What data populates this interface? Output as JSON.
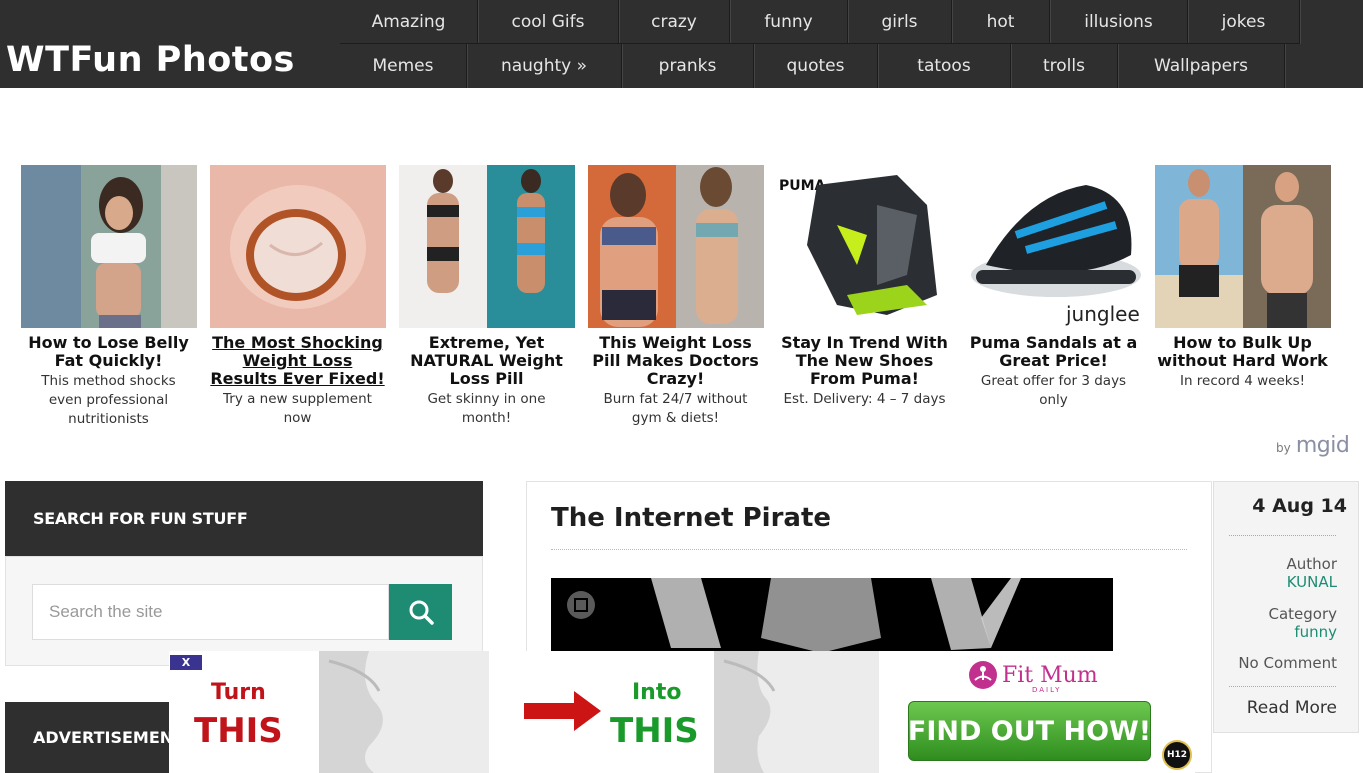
{
  "site": {
    "logo": "WTFun Photos"
  },
  "nav": {
    "row1": [
      "Amazing",
      "cool Gifs",
      "crazy",
      "funny",
      "girls",
      "hot",
      "illusions",
      "jokes"
    ],
    "row2": [
      "Memes",
      "naughty »",
      "pranks",
      "quotes",
      "tatoos",
      "trolls",
      "Wallpapers"
    ]
  },
  "ads": [
    {
      "title": "How to Lose Belly Fat Quickly!",
      "desc": "This method shocks even professional nutritionists",
      "underlined": false
    },
    {
      "title": "The Most Shocking Weight Loss Results Ever Fixed!",
      "desc": "Try a new supplement now",
      "underlined": true
    },
    {
      "title": "Extreme, Yet NATURAL Weight Loss Pill",
      "desc": "Get skinny in one month!",
      "underlined": false
    },
    {
      "title": "This Weight Loss Pill Makes Doctors Crazy!",
      "desc": "Burn fat 24/7 without gym & diets!",
      "underlined": false
    },
    {
      "title": "Stay In Trend With The New Shoes From Puma!",
      "desc": "Est. Delivery: 4 – 7 days",
      "underlined": false
    },
    {
      "title": "Puma Sandals at a Great Price!",
      "desc": "Great offer for 3 days only",
      "underlined": false
    },
    {
      "title": "How to Bulk Up without Hard Work",
      "desc": "In record 4 weeks!",
      "underlined": false
    }
  ],
  "ad_labels": {
    "puma": "PUMA",
    "junglee": "junglee"
  },
  "mgid": {
    "by": "by",
    "brand": "mgid"
  },
  "search": {
    "heading": "SEARCH FOR FUN STUFF",
    "placeholder": "Search the site"
  },
  "advert_heading": "ADVERTISEMENT",
  "post": {
    "title": "The Internet Pirate",
    "date": "4 Aug 14",
    "author_label": "Author",
    "author": "KUNAL",
    "category_label": "Category",
    "category": "funny",
    "comments": "No Comment",
    "read_more": "Read More"
  },
  "overlay_ad": {
    "close": "X",
    "turn": "Turn",
    "this1": "THIS",
    "into": "Into",
    "this2": "THIS",
    "brand": "Fit Mum",
    "brand_sub": "DAILY",
    "cta": "FIND OUT HOW!",
    "badge": "H12"
  },
  "colors": {
    "header_bg": "#2f2f2f",
    "accent_green": "#1e8c73",
    "ad_red": "#c0141a",
    "ad_green": "#1a9a2a"
  }
}
